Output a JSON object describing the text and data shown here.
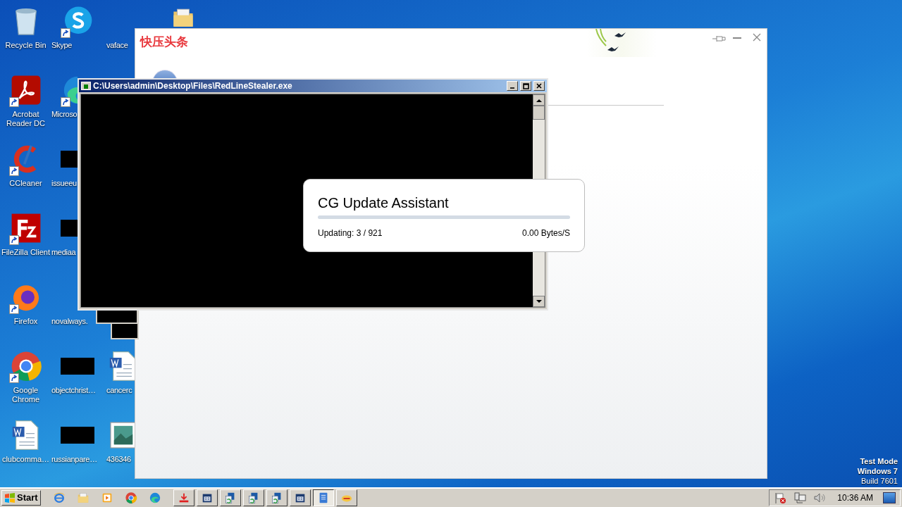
{
  "desktop": {
    "columns": [
      [
        {
          "label": "Recycle Bin",
          "kind": "recycle",
          "shortcut": false
        },
        {
          "label": "Acrobat Reader DC",
          "kind": "pdf",
          "shortcut": true
        },
        {
          "label": "CCleaner",
          "kind": "ccleaner",
          "shortcut": true
        },
        {
          "label": "FileZilla Client",
          "kind": "filezilla",
          "shortcut": true
        },
        {
          "label": "Firefox",
          "kind": "firefox",
          "shortcut": true
        },
        {
          "label": "Google Chrome",
          "kind": "chrome",
          "shortcut": true
        },
        {
          "label": "clubcomma…",
          "kind": "word",
          "shortcut": false
        }
      ],
      [
        {
          "label": "Skype",
          "kind": "skype",
          "shortcut": true
        },
        {
          "label": "Microso",
          "kind": "edge",
          "shortcut": true
        },
        {
          "label": "issueeu",
          "kind": "redacted",
          "shortcut": false
        },
        {
          "label": "mediaa",
          "kind": "redacted",
          "shortcut": false
        },
        {
          "label": "novalways.",
          "kind": "hidden",
          "shortcut": false
        },
        {
          "label": "objectchrist…",
          "kind": "redacted",
          "shortcut": false
        },
        {
          "label": "russianpare…",
          "kind": "redacted",
          "shortcut": false
        }
      ],
      [
        {
          "label": "vaface",
          "kind": "hidden",
          "shortcut": false
        },
        {
          "label": "cancerc",
          "kind": "word",
          "shortcut": false
        },
        {
          "label": "436346",
          "kind": "image",
          "shortcut": false
        }
      ]
    ]
  },
  "news_window": {
    "title": "快压头条"
  },
  "console_window": {
    "title": "C:\\Users\\admin\\Desktop\\Files\\RedLineStealer.exe"
  },
  "update_dialog": {
    "title": "CG Update Assistant",
    "progress": {
      "level": 0.0
    },
    "status": "Updating: 3 / 921",
    "speed": "0.00 Bytes/S"
  },
  "watermark": {
    "lines": [
      "Test Mode",
      "Windows 7",
      "Build 7601"
    ]
  },
  "taskbar": {
    "start": "Start",
    "quick_launch": [
      {
        "kind": "ie"
      },
      {
        "kind": "folder"
      },
      {
        "kind": "media"
      },
      {
        "kind": "chrome"
      },
      {
        "kind": "edge"
      }
    ],
    "tasks": [
      {
        "kind": "download",
        "selected": false
      },
      {
        "kind": "app",
        "selected": false
      },
      {
        "kind": "setup",
        "selected": false
      },
      {
        "kind": "setup",
        "selected": false
      },
      {
        "kind": "setup",
        "selected": false
      },
      {
        "kind": "app",
        "selected": false
      },
      {
        "kind": "doc",
        "selected": true
      },
      {
        "kind": "logo",
        "selected": false
      }
    ],
    "clock": "10:36 AM"
  }
}
